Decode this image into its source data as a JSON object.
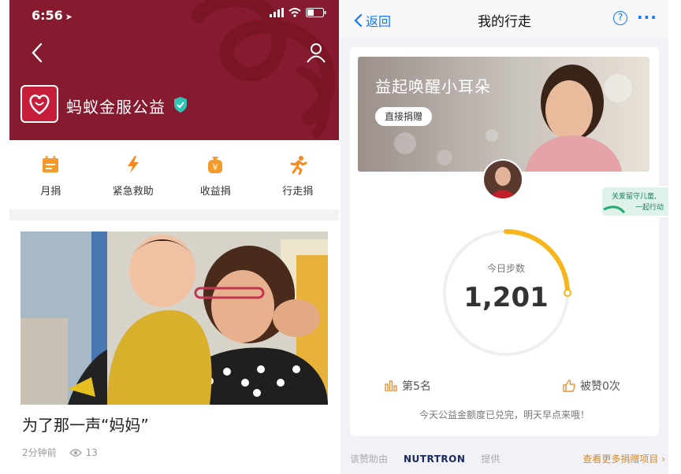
{
  "left_phone": {
    "status_bar": {
      "time": "6:56"
    },
    "header": {
      "brand_name": "蚂蚁金服公益",
      "header_color": "#861a2f"
    },
    "quick_actions": [
      {
        "label": "月捐",
        "icon": "calendar-icon"
      },
      {
        "label": "紧急救助",
        "icon": "lightning-icon"
      },
      {
        "label": "收益捐",
        "icon": "money-bag-icon"
      },
      {
        "label": "行走捐",
        "icon": "walking-person-icon"
      }
    ],
    "article": {
      "title": "为了那一声“妈妈”",
      "time": "2分钟前",
      "views": "13"
    }
  },
  "right_phone": {
    "nav": {
      "back_label": "返回",
      "title": "我的行走"
    },
    "banner": {
      "title": "益起唤醒小耳朵",
      "donate_button": "直接捐赠"
    },
    "side_badge": {
      "line1": "关爱留守儿童,",
      "line2": "一起行动"
    },
    "steps": {
      "label": "今日步数",
      "value": "1,201",
      "progress": 0.25
    },
    "rank": "第5名",
    "likes": "被赞0次",
    "notice": "今天公益金额度已兑完，明天早点来哦！",
    "footer": {
      "prefix": "该赞助由",
      "sponsor": "NUTRTRON",
      "suffix": "提供",
      "more_link": "查看更多捐赠项目"
    },
    "accent_color": "#f5b51b",
    "link_color": "#1478ff"
  }
}
